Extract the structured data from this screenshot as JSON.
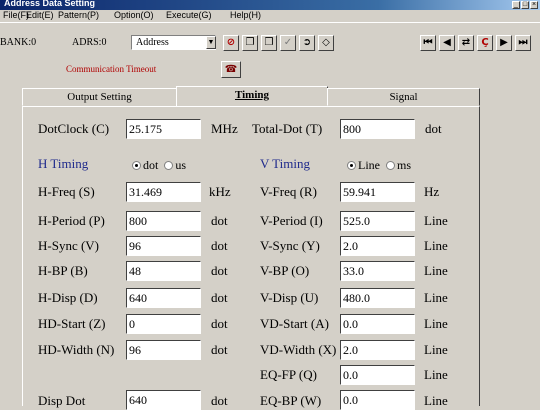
{
  "window": {
    "title": "Address Data Setting"
  },
  "menu": [
    "File(F)",
    "Edit(E)",
    "Pattern(P)",
    "Option(O)",
    "Execute(G)",
    "Help(H)"
  ],
  "toolbar": {
    "bank": "BANK:0",
    "adrs": "ADRS:0",
    "combo_value": "Address",
    "comm_timeout": "Communication Timeout"
  },
  "tabs": [
    {
      "label": "Output Setting",
      "active": false
    },
    {
      "label": "Timing",
      "active": true
    },
    {
      "label": "Signal",
      "active": false
    }
  ],
  "top": {
    "dotclock_label": "DotClock (C)",
    "dotclock_value": "25.175",
    "dotclock_unit": "MHz",
    "totaldot_label": "Total-Dot (T)",
    "totaldot_value": "800",
    "totaldot_unit": "dot"
  },
  "h_timing": {
    "heading": "H Timing",
    "radio_dot": "dot",
    "radio_us": "us",
    "rows": [
      {
        "label": "H-Freq (S)",
        "value": "31.469",
        "unit": "kHz"
      },
      {
        "label": "H-Period (P)",
        "value": "800",
        "unit": "dot"
      },
      {
        "label": "H-Sync (V)",
        "value": "96",
        "unit": "dot"
      },
      {
        "label": "H-BP (B)",
        "value": "48",
        "unit": "dot"
      },
      {
        "label": "H-Disp (D)",
        "value": "640",
        "unit": "dot"
      },
      {
        "label": "HD-Start (Z)",
        "value": "0",
        "unit": "dot"
      },
      {
        "label": "HD-Width (N)",
        "value": "96",
        "unit": "dot"
      }
    ],
    "disp_dot": {
      "label": "Disp Dot",
      "value": "640",
      "unit": "dot"
    }
  },
  "v_timing": {
    "heading": "V Timing",
    "radio_line": "Line",
    "radio_ms": "ms",
    "rows": [
      {
        "label": "V-Freq (R)",
        "value": "59.941",
        "unit": "Hz"
      },
      {
        "label": "V-Period (I)",
        "value": "525.0",
        "unit": "Line"
      },
      {
        "label": "V-Sync (Y)",
        "value": "2.0",
        "unit": "Line"
      },
      {
        "label": "V-BP (O)",
        "value": "33.0",
        "unit": "Line"
      },
      {
        "label": "V-Disp (U)",
        "value": "480.0",
        "unit": "Line"
      },
      {
        "label": "VD-Start (A)",
        "value": "0.0",
        "unit": "Line"
      },
      {
        "label": "VD-Width (X)",
        "value": "2.0",
        "unit": "Line"
      },
      {
        "label": "EQ-FP (Q)",
        "value": "0.0",
        "unit": "Line"
      },
      {
        "label": "EQ-BP (W)",
        "value": "0.0",
        "unit": "Line"
      }
    ]
  }
}
